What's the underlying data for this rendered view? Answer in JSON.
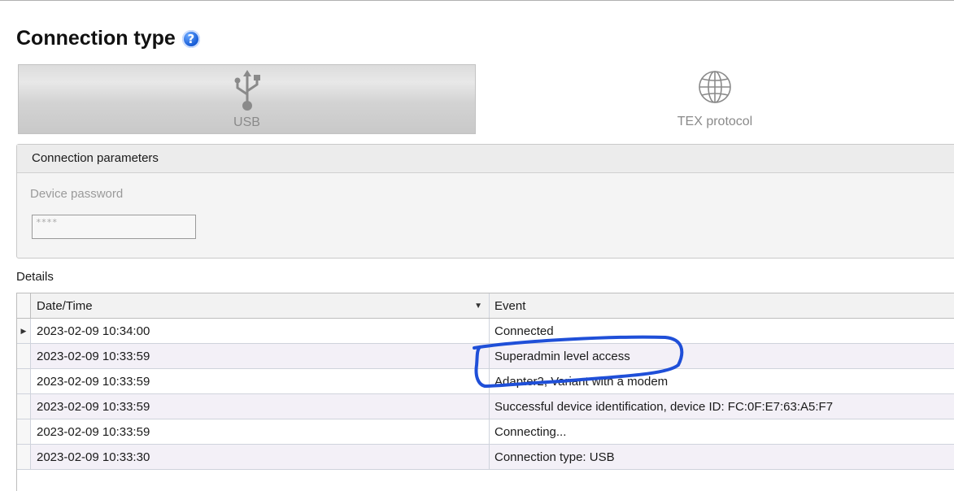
{
  "header": {
    "title": "Connection type",
    "help_icon": "help-icon"
  },
  "tabs": [
    {
      "label": "USB",
      "icon": "usb-icon",
      "selected": true
    },
    {
      "label": "TEX protocol",
      "icon": "globe-icon",
      "selected": false
    }
  ],
  "connection_parameters": {
    "title": "Connection parameters",
    "password_label": "Device password",
    "password_value": "****"
  },
  "details": {
    "label": "Details",
    "columns": {
      "datetime": "Date/Time",
      "event": "Event"
    },
    "rows": [
      {
        "datetime": "2023-02-09 10:34:00",
        "event": "Connected",
        "current": true
      },
      {
        "datetime": "2023-02-09 10:33:59",
        "event": "Superadmin level access"
      },
      {
        "datetime": "2023-02-09 10:33:59",
        "event": "Adapter2, Variant with a modem"
      },
      {
        "datetime": "2023-02-09 10:33:59",
        "event": "Successful device identification, device ID: FC:0F:E7:63:A5:F7"
      },
      {
        "datetime": "2023-02-09 10:33:59",
        "event": "Connecting..."
      },
      {
        "datetime": "2023-02-09 10:33:30",
        "event": "Connection type: USB"
      }
    ]
  },
  "colors": {
    "annotation_stroke": "#1f4fd8",
    "help_icon": "#1a5fd8"
  }
}
